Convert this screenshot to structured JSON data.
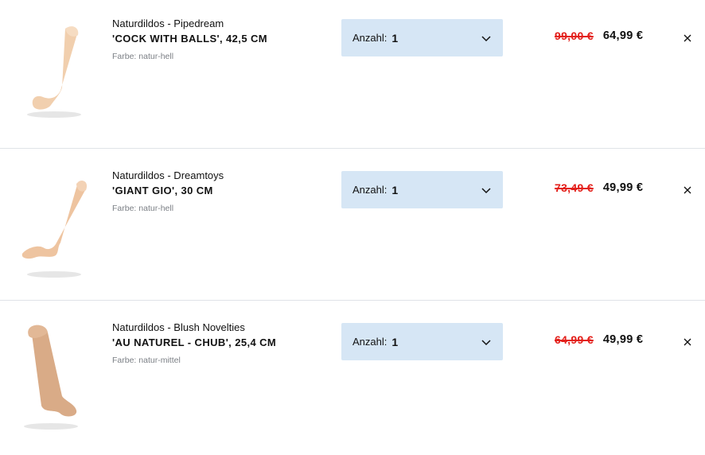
{
  "cart": {
    "quantity_label": "Anzahl:",
    "items": [
      {
        "category": "Naturdildos - Pipedream",
        "title": "'COCK WITH BALLS', 42,5 CM",
        "color": "Farbe: natur-hell",
        "quantity": "1",
        "old_price": "99,00 €",
        "new_price": "64,99 €",
        "image_icon": "product-image",
        "product_color": "#f1cfae"
      },
      {
        "category": "Naturdildos - Dreamtoys",
        "title": "'GIANT GIO', 30 CM",
        "color": "Farbe: natur-hell",
        "quantity": "1",
        "old_price": "73,49 €",
        "new_price": "49,99 €",
        "image_icon": "product-image",
        "product_color": "#eec4a0"
      },
      {
        "category": "Naturdildos - Blush Novelties",
        "title": "'AU NATUREL - CHUB', 25,4 CM",
        "color": "Farbe: natur-mittel",
        "quantity": "1",
        "old_price": "64,99 €",
        "new_price": "49,99 €",
        "image_icon": "product-image",
        "product_color": "#d9ab87"
      }
    ],
    "remove_icon": "close-icon",
    "dropdown_icon": "chevron-down-icon",
    "colors": {
      "old_price": "#e3201b",
      "quantity_bg": "#d6e6f5"
    }
  }
}
